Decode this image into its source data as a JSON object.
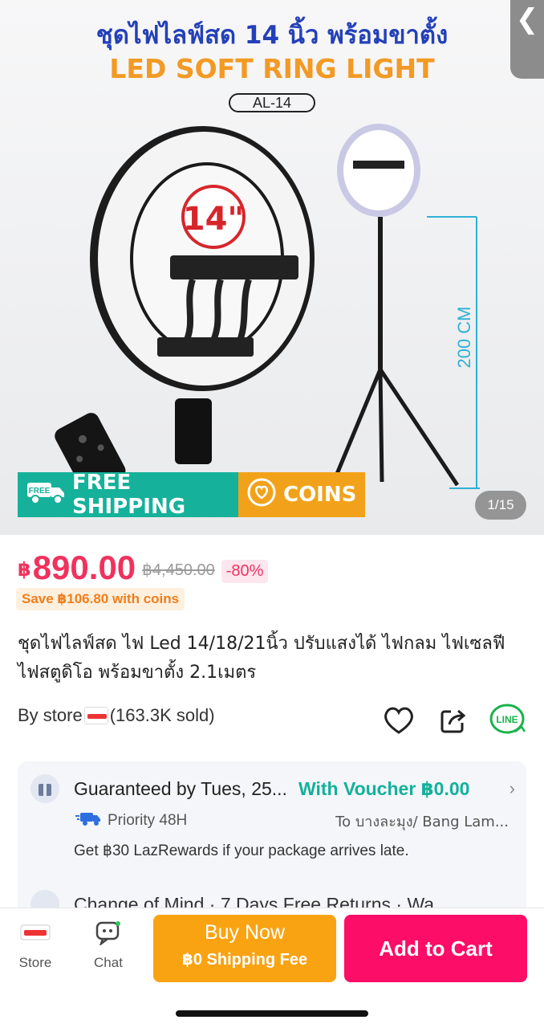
{
  "hero": {
    "back_glyph": "❮",
    "title_th": "ชุดไฟไลฟ์สด 14 นิ้ว พร้อมขาตั้ง",
    "title_en": "LED SOFT RING LIGHT",
    "model": "AL-14",
    "size_badge": "14\"",
    "height_label": "200 CM",
    "free_shipping": "FREE SHIPPING",
    "free_tag": "FREE",
    "coins": "COINS",
    "image_counter": "1/15"
  },
  "price": {
    "currency": "฿",
    "current": "890.00",
    "original": "฿4,450.00",
    "discount": "-80%",
    "coin_save": "Save ฿106.80 with coins"
  },
  "product": {
    "title": "ชุดไฟไลฟ์สด ไฟ Led 14/18/21นิ้ว ปรับแสงได้ ไฟกลม ไฟเซลฟี ไฟสตูดิโอ พร้อมขาตั้ง 2.1เมตร"
  },
  "store": {
    "prefix": "By store",
    "sold": "(163.3K sold)",
    "line_label": "LINE"
  },
  "delivery": {
    "guarantee": "Guaranteed by Tues, 25...",
    "voucher": "With Voucher ฿0.00",
    "priority": "Priority 48H",
    "destination": "To บางละมุง/ Bang Lam...",
    "lazrewards": "Get ฿30 LazRewards if your package arrives late.",
    "returns": "Change of Mind  ·  7 Days Free Returns  ·  Wa..."
  },
  "bottom": {
    "store_label": "Store",
    "chat_label": "Chat",
    "buy_now": "Buy Now",
    "buy_now_sub": "฿0 Shipping Fee",
    "add_to_cart": "Add to Cart"
  },
  "colors": {
    "price_pink": "#f0325e",
    "teal": "#13b19b",
    "buy_now_orange": "#f9a313",
    "add_cart_pink": "#fc0d67"
  }
}
